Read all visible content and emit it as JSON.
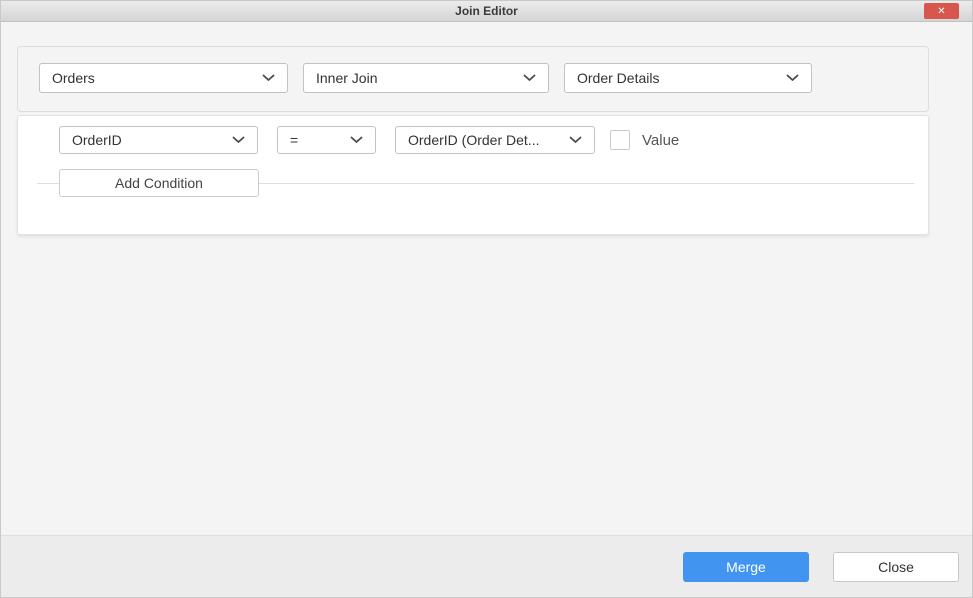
{
  "window": {
    "title": "Join Editor",
    "close_icon_glyph": "✕"
  },
  "join_row": {
    "left_table": "Orders",
    "join_type": "Inner Join",
    "right_table": "Order Details"
  },
  "condition": {
    "left_field": "OrderID",
    "operator": "=",
    "right_field": "OrderID (Order Det...",
    "value_label": "Value",
    "value_checked": false
  },
  "actions": {
    "add_condition_label": "Add Condition",
    "merge_label": "Merge",
    "close_label": "Close"
  },
  "colors": {
    "merge_button_blue": "#4194f0",
    "titlebar_close_red": "#d7574f",
    "panel_background": "#f4f4f4",
    "condition_panel_background": "#ffffff"
  }
}
